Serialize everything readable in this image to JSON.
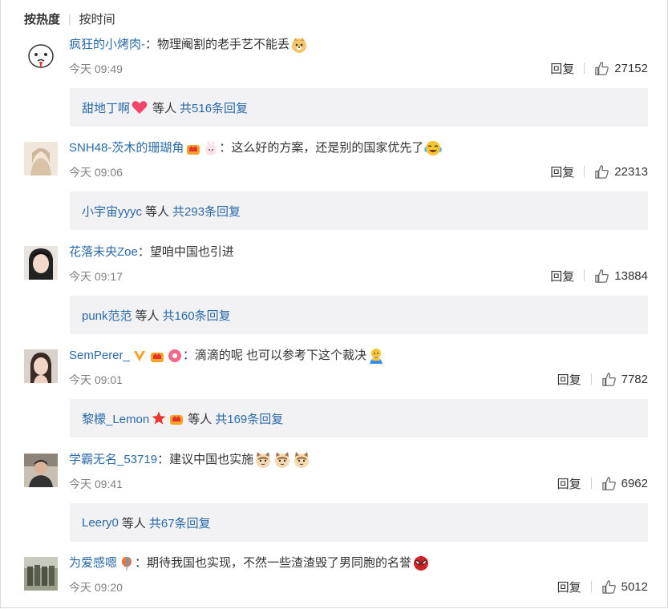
{
  "sort": {
    "hot": "按热度",
    "time": "按时间"
  },
  "reply_label": "回复",
  "comments": [
    {
      "user": "疯狂的小烤肉-",
      "text": "物理阉割的老手艺不能丢",
      "time": "今天 09:49",
      "likes": "27152",
      "sub": {
        "user": "甜地丁啊",
        "rest": "等人",
        "total": "共516条回复"
      }
    },
    {
      "user": "SNH48-茨木的珊瑚角",
      "text": "这么好的方案，还是别的国家优先了",
      "time": "今天 09:06",
      "likes": "22313",
      "sub": {
        "user": "小宇宙yyyc",
        "rest": "等人",
        "total": "共293条回复"
      }
    },
    {
      "user": "花落未央Zoe",
      "text": "望咱中国也引进",
      "time": "今天 09:17",
      "likes": "13884",
      "sub": {
        "user": "punk范范",
        "rest": "等人",
        "total": "共160条回复"
      }
    },
    {
      "user": "SemPerer_",
      "text": "滴滴的呢 也可以参考下这个裁决",
      "time": "今天 09:01",
      "likes": "7782",
      "sub": {
        "user": "黎檬_Lemon",
        "rest": "等人",
        "total": "共169条回复"
      }
    },
    {
      "user": "学霸无名_53719",
      "text": "建议中国也实施",
      "time": "今天 09:41",
      "likes": "6962",
      "sub": {
        "user": "Leery0",
        "rest": "等人",
        "total": "共67条回复"
      }
    },
    {
      "user": "为爱感嗯",
      "text": "期待我国也实现，不然一些渣渣毁了男同胞的名誉",
      "time": "今天 09:20",
      "likes": "5012"
    }
  ],
  "colon": "："
}
